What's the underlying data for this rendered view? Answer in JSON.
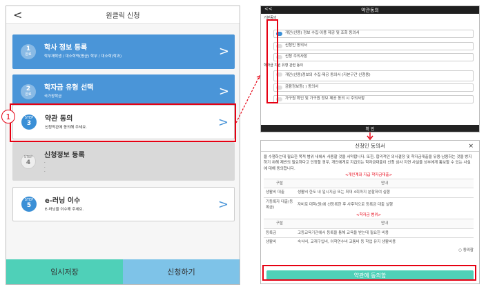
{
  "left": {
    "title": "원클릭 신청",
    "back": "<",
    "cards": [
      {
        "badge_top": "1",
        "badge_bottom": "완료",
        "title": "학사 정보 등록",
        "sub": "학부재학생 / 대소학력(평균) 학부 / 대소학(학과)"
      },
      {
        "badge_top": "2",
        "badge_bottom": "완료",
        "title": "학자금 유형 선택",
        "sub": "국가장학금"
      },
      {
        "badge_top": "STEP",
        "badge_bottom": "3",
        "title": "약관 동의",
        "sub": "신청약관에 동의해 주세요."
      },
      {
        "badge_top": "STEP",
        "badge_bottom": "4",
        "title": "신청정보 등록",
        "sub": "·\n·\n·"
      },
      {
        "badge_top": "STEP",
        "badge_bottom": "5",
        "title": "e-러닝 이수",
        "sub": "E-러닝을 이수해 주세요."
      }
    ],
    "chevron": ">",
    "save_label": "임시저장",
    "apply_label": "신청하기",
    "marker_number": "1"
  },
  "right_top": {
    "back": "<<",
    "title": "약관동의",
    "section1": "기본동의",
    "items1": [
      "개인(신용) 정보 수집·이용 제공 및 조회 동의서",
      "신청인 동의서",
      "신청 주의사항"
    ],
    "section2": "학자금 지원 유형 관련 동의",
    "items2": [
      "개인(신용)정보의 수집·제공 동의서 (자본구간 신청용)",
      "금융정보등(    ) 동의서",
      "가구원 확인 및 가구원 정보 제공 동의 시 주의사항"
    ],
    "confirm": "확 인"
  },
  "right_bottom": {
    "title": "신청인 동의서",
    "close": "×",
    "intro": "을 수행하는데 필요한 목적 범위 내에서 사용할 것을 서약합니다. 또한, 합리적인 의사결정 및 학자금대출을 유용·남용하는 것을 방지하기 위해 제반의 필요하다고 인정할 경우, 개인에게로 지급되는 학자금대출이 신청 심사 지연 사실을 상부에게 통보할 수 있는 사실에 대해 동의합니다.",
    "sec1": "<개인계좌 지급 학자금대출>",
    "table1_head": [
      "구분",
      "안내"
    ],
    "table1": [
      [
        "생활비 대출",
        "생활비 한도 내 일시지급 또는 최대 4회까지 분할하여 실행"
      ],
      [
        "기등록자 대출(등록금)",
        "자비로 대학(원)에 선등록한 후 사후적으로 등록금 대출 실행"
      ]
    ],
    "sec2": "<학자금 범위>",
    "table2_head": [
      "구분",
      "안내"
    ],
    "table2": [
      [
        "등록금",
        "고등교육기관에서 등록을 통해 교육을 받는데 필요한 비용"
      ],
      [
        "생활비",
        "숙식비, 교재구입비, 어학연수비 교통비 등 학업 유지 생활비용"
      ]
    ],
    "check_label": "동의함",
    "agree_button": "약관에 동의함"
  }
}
